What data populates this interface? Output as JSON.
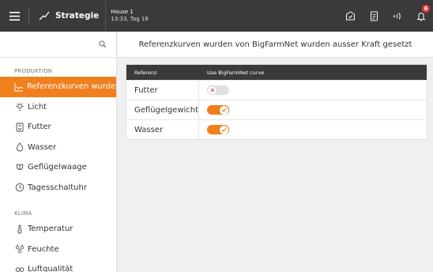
{
  "topbar": {
    "strategy_label": "Strategie",
    "house_name": "House 1",
    "house_time": "13:33, Tag 18",
    "notification_count": "6"
  },
  "sidebar": {
    "sections": [
      {
        "label": "PRODUKTION",
        "items": [
          {
            "label": "Referenzkurven wurde…",
            "icon": "curve-icon",
            "active": true
          },
          {
            "label": "Licht",
            "icon": "light-icon",
            "active": false
          },
          {
            "label": "Futter",
            "icon": "feed-icon",
            "active": false
          },
          {
            "label": "Wasser",
            "icon": "water-drop-icon",
            "active": false
          },
          {
            "label": "Geflügelwaage",
            "icon": "scale-icon",
            "active": false
          },
          {
            "label": "Tagesschaltuhr",
            "icon": "clock-icon",
            "active": false
          }
        ]
      },
      {
        "label": "KLIMA",
        "items": [
          {
            "label": "Temperatur",
            "icon": "thermometer-icon",
            "active": false
          },
          {
            "label": "Feuchte",
            "icon": "humidity-icon",
            "active": false
          },
          {
            "label": "Luftqualität",
            "icon": "air-quality-icon",
            "active": false
          }
        ]
      }
    ]
  },
  "main": {
    "header": "Referenzkurven wurden von BigFarmNet wurden ausser Kraft gesetzt",
    "table": {
      "columns": [
        "Referenz",
        "Use BigFarmNet curve"
      ],
      "rows": [
        {
          "referenz": "Futter",
          "enabled": false
        },
        {
          "referenz": "Geflügelgewicht",
          "enabled": true
        },
        {
          "referenz": "Wasser",
          "enabled": true
        }
      ]
    }
  },
  "colors": {
    "accent": "#f07f1d",
    "topbar": "#3a3a3a",
    "toggle_off": "#e0e0e0",
    "badge": "#e53935"
  }
}
